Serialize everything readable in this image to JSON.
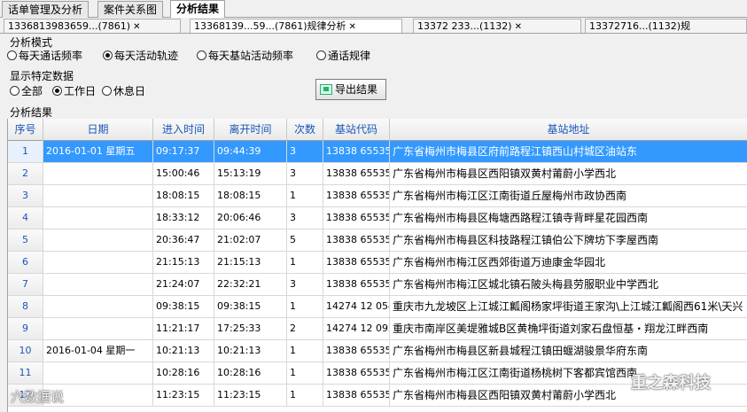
{
  "top_tabs": [
    "话单管理及分析",
    "案件关系图",
    "分析结果"
  ],
  "record_tabs": [
    "1336813983659...(7861)",
    "13368139...59...(7861)规律分析",
    "13372 233...(1132)",
    "13372716...(1132)规"
  ],
  "mode_group": {
    "title": "分析模式",
    "options": [
      "每天通话频率",
      "每天活动轨迹",
      "每天基站活动频率",
      "通话规律"
    ],
    "selected": 1
  },
  "filter_group": {
    "title": "显示特定数据",
    "options": [
      "全部",
      "工作日",
      "休息日"
    ],
    "selected": 1
  },
  "export_label": "导出结果",
  "results_title": "分析结果",
  "columns": [
    "序号",
    "日期",
    "进入时间",
    "离开时间",
    "次数",
    "基站代码",
    "基站地址"
  ],
  "rows": [
    {
      "no": "1",
      "date": "2016-01-01  星期五",
      "in": "09:17:37",
      "out": "09:44:39",
      "count": "3",
      "code": "13838  65535",
      "addr": "广东省梅州市梅县区府前路程江镇西山村城区油站东"
    },
    {
      "no": "2",
      "date": "",
      "in": "15:00:46",
      "out": "15:13:19",
      "count": "3",
      "code": "13838  65535",
      "addr": "广东省梅州市梅县区西阳镇双黄村莆蔚小学西北"
    },
    {
      "no": "3",
      "date": "",
      "in": "18:08:15",
      "out": "18:08:15",
      "count": "1",
      "code": "13838  65535",
      "addr": "广东省梅州市梅江区江南街道丘屋梅州市政协西南"
    },
    {
      "no": "4",
      "date": "",
      "in": "18:33:12",
      "out": "20:06:46",
      "count": "3",
      "code": "13838  65535",
      "addr": "广东省梅州市梅县区梅塘西路程江镇寺背畔星花园西南"
    },
    {
      "no": "5",
      "date": "",
      "in": "20:36:47",
      "out": "21:02:07",
      "count": "5",
      "code": "13838  65535",
      "addr": "广东省梅州市梅县区科技路程江镇伯公下牌坊下李屋西南"
    },
    {
      "no": "6",
      "date": "",
      "in": "21:15:13",
      "out": "21:15:13",
      "count": "1",
      "code": "13838  65535",
      "addr": "广东省梅州市梅江区西郊街道万迪康金华园北"
    },
    {
      "no": "7",
      "date": "",
      "in": "21:24:07",
      "out": "22:32:21",
      "count": "3",
      "code": "13838  65535",
      "addr": "广东省梅州市梅江区城北镇石陂头梅县劳服职业中学西北"
    },
    {
      "no": "8",
      "date": "",
      "in": "09:38:15",
      "out": "09:38:15",
      "count": "1",
      "code": "14274  12  0540",
      "addr": "重庆市九龙坡区上江城江瓤阁杨家坪街道王家沟\\上江城江瓤阁西61米\\天兴"
    },
    {
      "no": "9",
      "date": "",
      "in": "11:21:17",
      "out": "17:25:33",
      "count": "2",
      "code": "14274  12  0923",
      "addr": "重庆市南岸区美堤雅城B区黄桷坪街道刘家石盘恒基・翔龙江畔西南"
    },
    {
      "no": "10",
      "date": "2016-01-04  星期一",
      "in": "10:21:13",
      "out": "10:21:13",
      "count": "1",
      "code": "13838  65535",
      "addr": "广东省梅州市梅县区新县城程江镇田蝘湖骏景华府东南"
    },
    {
      "no": "11",
      "date": "",
      "in": "10:28:16",
      "out": "10:28:16",
      "count": "1",
      "code": "13838  65535",
      "addr": "广东省梅州市梅江区江南街道杨桃树下客都宾馆西南"
    },
    {
      "no": "12",
      "date": "",
      "in": "11:23:15",
      "out": "11:23:15",
      "count": "1",
      "code": "13838  65535",
      "addr": "广东省梅州市梅县区西阳镇双黄村莆蔚小学西北"
    }
  ],
  "watermarks": [
    "六数据说",
    "重之森科技"
  ]
}
